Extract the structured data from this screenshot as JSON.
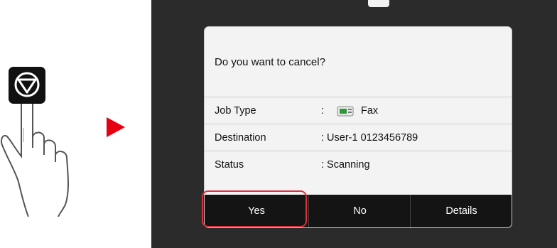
{
  "dialog": {
    "question": "Do you want to cancel?",
    "rows": [
      {
        "label": "Job Type",
        "colon": ":",
        "value": "Fax",
        "icon": "fax-icon"
      },
      {
        "label": "Destination",
        "colon": "",
        "value": ": User-1 0123456789"
      },
      {
        "label": "Status",
        "colon": "",
        "value": ": Scanning"
      }
    ],
    "buttons": {
      "yes": "Yes",
      "no": "No",
      "details": "Details"
    }
  },
  "illustration": {
    "stop_key_icon": "stop-icon",
    "hand_icon": "pointing-hand-icon",
    "arrow_icon": "right-arrow-icon",
    "arrow_color": "#e60012",
    "highlight_color": "#e0303a"
  }
}
